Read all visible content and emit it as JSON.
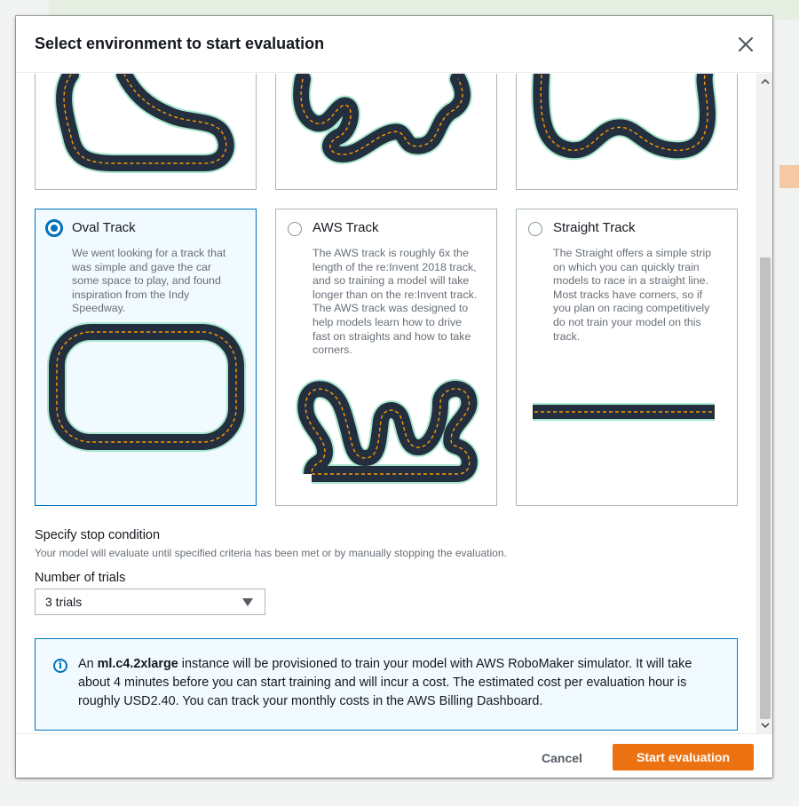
{
  "modal": {
    "title": "Select environment to start evaluation"
  },
  "tracks": [
    {
      "title": "Oval Track",
      "description": "We went looking for a track that was simple and gave the car some space to play, and found inspiration from the Indy Speedway.",
      "selected": true
    },
    {
      "title": "AWS Track",
      "description": "The AWS track is roughly 6x the length of the re:Invent 2018 track, and so training a model will take longer than on the re:Invent track. The AWS track was designed to help models learn how to drive fast on straights and how to take corners.",
      "selected": false
    },
    {
      "title": "Straight Track",
      "description": "The Straight offers a simple strip on which you can quickly train models to race in a straight line. Most tracks have corners, so if you plan on racing competitively do not train your model on this track.",
      "selected": false
    }
  ],
  "stop_condition": {
    "label": "Specify stop condition",
    "help": "Your model will evaluate until specified criteria has been met or by manually stopping the evaluation."
  },
  "trials": {
    "label": "Number of trials",
    "value": "3 trials"
  },
  "info": {
    "prefix": "An ",
    "instance": "ml.c4.2xlarge",
    "suffix": " instance will be provisioned to train your model with AWS RoboMaker simulator. It will take about 4 minutes before you can start training and will incur a cost. The estimated cost per evaluation hour is roughly USD2.40. You can track your monthly costs in the AWS Billing Dashboard."
  },
  "footer": {
    "cancel_label": "Cancel",
    "start_label": "Start evaluation"
  },
  "colors": {
    "accent": "#0073bb",
    "primary_button": "#ec7211",
    "track_asphalt": "#232f3e",
    "track_center_line": "#ff9900",
    "track_edge": "#a8e6cf"
  },
  "icons": {
    "close": "close-icon",
    "info": "info-icon",
    "dropdown": "caret-down-icon"
  }
}
